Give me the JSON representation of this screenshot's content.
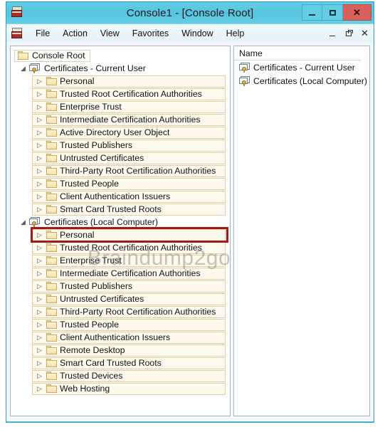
{
  "window": {
    "title": "Console1 - [Console Root]",
    "app_icon": "mmc-console-icon",
    "buttons": {
      "minimize": "minimize-icon",
      "maximize": "maximize-icon",
      "close": "✕"
    }
  },
  "menubar": {
    "icon": "mmc-console-icon",
    "items": [
      {
        "label": "File"
      },
      {
        "label": "Action"
      },
      {
        "label": "View"
      },
      {
        "label": "Favorites"
      },
      {
        "label": "Window"
      },
      {
        "label": "Help"
      }
    ],
    "mdi_buttons": {
      "minimize": "mdi-minimize-icon",
      "restore": "mdi-restore-icon",
      "close": "✕"
    }
  },
  "tree": {
    "root": {
      "label": "Console Root",
      "icon": "folder-icon"
    },
    "nodes": [
      {
        "label": "Certificates - Current User",
        "icon": "certificate-store-icon",
        "expanded": true,
        "children": [
          {
            "label": "Personal"
          },
          {
            "label": "Trusted Root Certification Authorities"
          },
          {
            "label": "Enterprise Trust"
          },
          {
            "label": "Intermediate Certification Authorities"
          },
          {
            "label": "Active Directory User Object"
          },
          {
            "label": "Trusted Publishers"
          },
          {
            "label": "Untrusted Certificates"
          },
          {
            "label": "Third-Party Root Certification Authorities"
          },
          {
            "label": "Trusted People"
          },
          {
            "label": "Client Authentication Issuers"
          },
          {
            "label": "Smart Card Trusted Roots"
          }
        ]
      },
      {
        "label": "Certificates (Local Computer)",
        "icon": "certificate-store-icon",
        "expanded": true,
        "children": [
          {
            "label": "Personal",
            "highlighted": true
          },
          {
            "label": "Trusted Root Certification Authorities"
          },
          {
            "label": "Enterprise Trust"
          },
          {
            "label": "Intermediate Certification Authorities"
          },
          {
            "label": "Trusted Publishers"
          },
          {
            "label": "Untrusted Certificates"
          },
          {
            "label": "Third-Party Root Certification Authorities"
          },
          {
            "label": "Trusted People"
          },
          {
            "label": "Client Authentication Issuers"
          },
          {
            "label": "Remote Desktop"
          },
          {
            "label": "Smart Card Trusted Roots"
          },
          {
            "label": "Trusted Devices"
          },
          {
            "label": "Web Hosting"
          }
        ]
      }
    ],
    "expander_collapsed": "▷",
    "expander_expanded": "◢"
  },
  "list": {
    "header": "Name",
    "rows": [
      {
        "label": "Certificates - Current User",
        "icon": "certificate-store-icon"
      },
      {
        "label": "Certificates (Local Computer)",
        "icon": "certificate-store-icon"
      }
    ]
  },
  "annotation": {
    "highlight_color": "#a71916",
    "highlight_target": "Personal"
  },
  "watermark": {
    "text": "Braindump2go.com"
  }
}
